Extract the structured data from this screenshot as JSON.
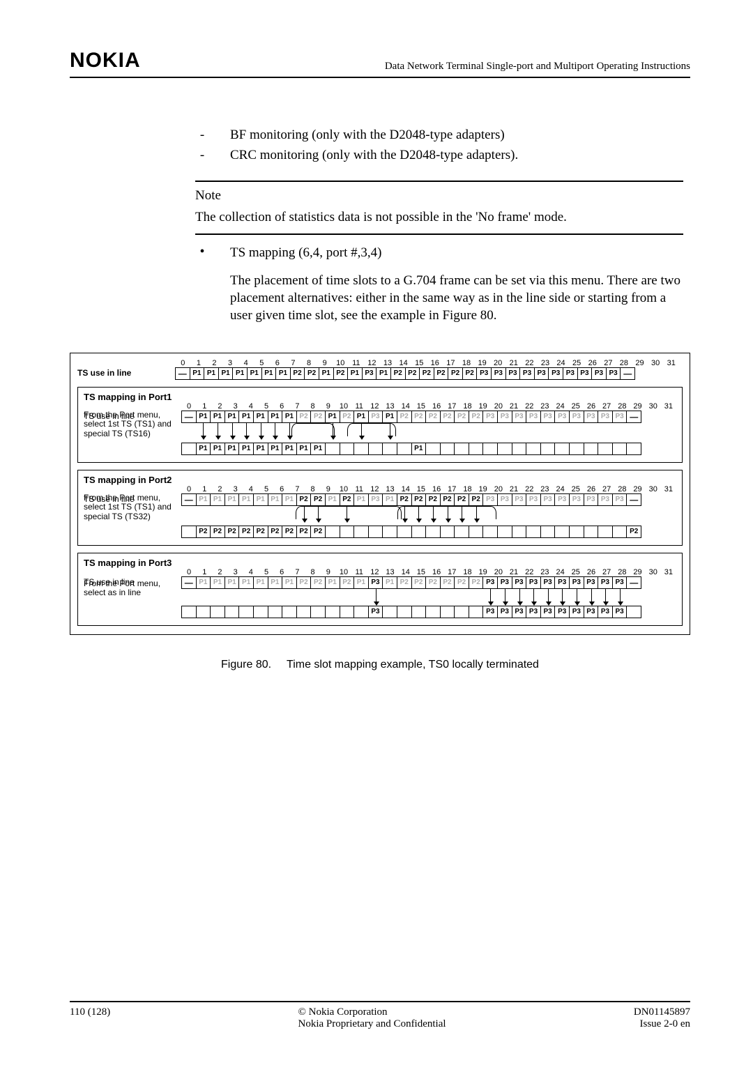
{
  "header": {
    "logo": "NOKIA",
    "doc_title": "Data Network Terminal Single-port and Multiport Operating Instructions"
  },
  "body": {
    "bullets": [
      "BF monitoring (only with the D2048-type adapters)",
      "CRC monitoring (only with the D2048-type adapters)."
    ],
    "note_label": "Note",
    "note_text": "The collection of statistics data is not possible in the 'No frame' mode.",
    "ts_bullet": "TS mapping (6,4, port #,3,4)",
    "ts_para": "The placement of time slots to a G.704 frame can be set via this menu. There are two placement alternatives: either in the same way as in the line side or starting from a user given time slot, see the example in Figure 80."
  },
  "figure": {
    "nums": [
      "0",
      "1",
      "2",
      "3",
      "4",
      "5",
      "6",
      "7",
      "8",
      "9",
      "10",
      "11",
      "12",
      "13",
      "14",
      "15",
      "16",
      "17",
      "18",
      "19",
      "20",
      "21",
      "22",
      "23",
      "24",
      "25",
      "26",
      "27",
      "28",
      "29",
      "30",
      "31"
    ],
    "top_label": "TS use in line",
    "top_cells": [
      "—",
      "P1",
      "P1",
      "P1",
      "P1",
      "P1",
      "P1",
      "P1",
      "P2",
      "P2",
      "P1",
      "P2",
      "P1",
      "P3",
      "P1",
      "P2",
      "P2",
      "P2",
      "P2",
      "P2",
      "P2",
      "P3",
      "P3",
      "P3",
      "P3",
      "P3",
      "P3",
      "P3",
      "P3",
      "P3",
      "P3",
      "—"
    ],
    "port1": {
      "title": "TS mapping in Port1",
      "line_label": "TS use in line",
      "line_cells": [
        {
          "t": "—"
        },
        {
          "t": "P1",
          "b": 1
        },
        {
          "t": "P1",
          "b": 1
        },
        {
          "t": "P1",
          "b": 1
        },
        {
          "t": "P1",
          "b": 1
        },
        {
          "t": "P1",
          "b": 1
        },
        {
          "t": "P1",
          "b": 1
        },
        {
          "t": "P1",
          "b": 1
        },
        {
          "t": "P2",
          "d": 1
        },
        {
          "t": "P2",
          "d": 1
        },
        {
          "t": "P1",
          "b": 1
        },
        {
          "t": "P2",
          "d": 1
        },
        {
          "t": "P1",
          "b": 1
        },
        {
          "t": "P3",
          "d": 1
        },
        {
          "t": "P1",
          "b": 1
        },
        {
          "t": "P2",
          "d": 1
        },
        {
          "t": "P2",
          "d": 1
        },
        {
          "t": "P2",
          "d": 1
        },
        {
          "t": "P2",
          "d": 1
        },
        {
          "t": "P2",
          "d": 1
        },
        {
          "t": "P2",
          "d": 1
        },
        {
          "t": "P3",
          "d": 1
        },
        {
          "t": "P3",
          "d": 1
        },
        {
          "t": "P3",
          "d": 1
        },
        {
          "t": "P3",
          "d": 1
        },
        {
          "t": "P3",
          "d": 1
        },
        {
          "t": "P3",
          "d": 1
        },
        {
          "t": "P3",
          "d": 1
        },
        {
          "t": "P3",
          "d": 1
        },
        {
          "t": "P3",
          "d": 1
        },
        {
          "t": "P3",
          "d": 1
        },
        {
          "t": "—"
        }
      ],
      "note": "From the Port menu, select 1st TS (TS1) and special TS (TS16)",
      "map_cells": [
        "",
        "P1",
        "P1",
        "P1",
        "P1",
        "P1",
        "P1",
        "P1",
        "P1",
        "P1",
        "",
        "",
        "",
        "",
        "",
        "",
        "P1",
        "",
        "",
        "",
        "",
        "",
        "",
        "",
        "",
        "",
        "",
        "",
        "",
        "",
        "",
        ""
      ]
    },
    "port2": {
      "title": "TS mapping in Port2",
      "line_label": "TS use in line",
      "line_cells": [
        {
          "t": "—"
        },
        {
          "t": "P1",
          "d": 1
        },
        {
          "t": "P1",
          "d": 1
        },
        {
          "t": "P1",
          "d": 1
        },
        {
          "t": "P1",
          "d": 1
        },
        {
          "t": "P1",
          "d": 1
        },
        {
          "t": "P1",
          "d": 1
        },
        {
          "t": "P1",
          "d": 1
        },
        {
          "t": "P2",
          "b": 1
        },
        {
          "t": "P2",
          "b": 1
        },
        {
          "t": "P1",
          "d": 1
        },
        {
          "t": "P2",
          "b": 1
        },
        {
          "t": "P1",
          "d": 1
        },
        {
          "t": "P3",
          "d": 1
        },
        {
          "t": "P1",
          "d": 1
        },
        {
          "t": "P2",
          "b": 1
        },
        {
          "t": "P2",
          "b": 1
        },
        {
          "t": "P2",
          "b": 1
        },
        {
          "t": "P2",
          "b": 1
        },
        {
          "t": "P2",
          "b": 1
        },
        {
          "t": "P2",
          "b": 1
        },
        {
          "t": "P3",
          "d": 1
        },
        {
          "t": "P3",
          "d": 1
        },
        {
          "t": "P3",
          "d": 1
        },
        {
          "t": "P3",
          "d": 1
        },
        {
          "t": "P3",
          "d": 1
        },
        {
          "t": "P3",
          "d": 1
        },
        {
          "t": "P3",
          "d": 1
        },
        {
          "t": "P3",
          "d": 1
        },
        {
          "t": "P3",
          "d": 1
        },
        {
          "t": "P3",
          "d": 1
        },
        {
          "t": "—"
        }
      ],
      "note": "From the Port menu, select 1st TS (TS1) and special TS (TS32)",
      "map_cells": [
        "",
        "P2",
        "P2",
        "P2",
        "P2",
        "P2",
        "P2",
        "P2",
        "P2",
        "P2",
        "",
        "",
        "",
        "",
        "",
        "",
        "",
        "",
        "",
        "",
        "",
        "",
        "",
        "",
        "",
        "",
        "",
        "",
        "",
        "",
        "",
        "P2"
      ]
    },
    "port3": {
      "title": "TS mapping in Port3",
      "line_label": "TS use in line",
      "line_cells": [
        {
          "t": "—"
        },
        {
          "t": "P1",
          "d": 1
        },
        {
          "t": "P1",
          "d": 1
        },
        {
          "t": "P1",
          "d": 1
        },
        {
          "t": "P1",
          "d": 1
        },
        {
          "t": "P1",
          "d": 1
        },
        {
          "t": "P1",
          "d": 1
        },
        {
          "t": "P1",
          "d": 1
        },
        {
          "t": "P2",
          "d": 1
        },
        {
          "t": "P2",
          "d": 1
        },
        {
          "t": "P1",
          "d": 1
        },
        {
          "t": "P2",
          "d": 1
        },
        {
          "t": "P1",
          "d": 1
        },
        {
          "t": "P3",
          "b": 1
        },
        {
          "t": "P1",
          "d": 1
        },
        {
          "t": "P2",
          "d": 1
        },
        {
          "t": "P2",
          "d": 1
        },
        {
          "t": "P2",
          "d": 1
        },
        {
          "t": "P2",
          "d": 1
        },
        {
          "t": "P2",
          "d": 1
        },
        {
          "t": "P2",
          "d": 1
        },
        {
          "t": "P3",
          "b": 1
        },
        {
          "t": "P3",
          "b": 1
        },
        {
          "t": "P3",
          "b": 1
        },
        {
          "t": "P3",
          "b": 1
        },
        {
          "t": "P3",
          "b": 1
        },
        {
          "t": "P3",
          "b": 1
        },
        {
          "t": "P3",
          "b": 1
        },
        {
          "t": "P3",
          "b": 1
        },
        {
          "t": "P3",
          "b": 1
        },
        {
          "t": "P3",
          "b": 1
        },
        {
          "t": "—"
        }
      ],
      "note": "From the Port menu, select as in line",
      "map_cells": [
        "",
        "",
        "",
        "",
        "",
        "",
        "",
        "",
        "",
        "",
        "",
        "",
        "",
        "P3",
        "",
        "",
        "",
        "",
        "",
        "",
        "",
        "P3",
        "P3",
        "P3",
        "P3",
        "P3",
        "P3",
        "P3",
        "P3",
        "P3",
        "P3",
        ""
      ]
    },
    "caption_prefix": "Figure 80.",
    "caption_text": "Time slot mapping example, TS0 locally terminated"
  },
  "footer": {
    "page": "110 (128)",
    "copyright": "© Nokia Corporation",
    "confidential": "Nokia Proprietary and Confidential",
    "docnum": "DN01145897",
    "issue": "Issue 2-0 en"
  }
}
